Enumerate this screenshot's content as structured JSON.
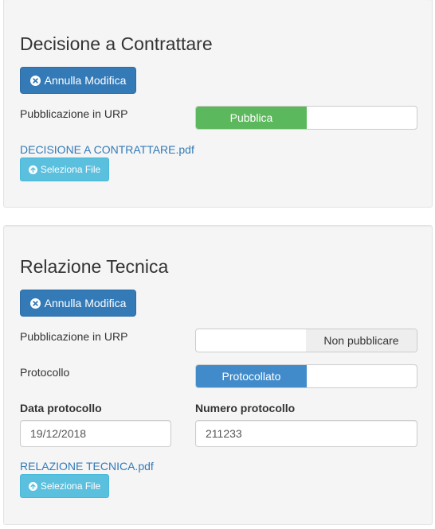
{
  "sections": [
    {
      "title": "Decisione a Contrattare",
      "cancel_button": "Annulla Modifica",
      "publication_label": "Pubblicazione in URP",
      "publication_toggle": {
        "on_label": "Pubblica",
        "off_label": "",
        "state": "on"
      },
      "file_link": "DECISIONE A CONTRATTARE.pdf",
      "select_file_button": "Seleziona File"
    },
    {
      "title": "Relazione Tecnica",
      "cancel_button": "Annulla Modifica",
      "publication_label": "Pubblicazione in URP",
      "publication_toggle": {
        "on_label": "",
        "off_label": "Non pubblicare",
        "state": "off"
      },
      "protocol_label": "Protocollo",
      "protocol_toggle": {
        "on_label": "Protocollato",
        "off_label": "",
        "state": "on"
      },
      "date_label": "Data protocollo",
      "date_value": "19/12/2018",
      "number_label": "Numero protocollo",
      "number_value": "211233",
      "file_link": "RELAZIONE TECNICA.pdf",
      "select_file_button": "Seleziona File"
    }
  ],
  "icons": {
    "cancel": "times-circle-icon",
    "upload": "upload-circle-icon"
  },
  "colors": {
    "primary": "#337ab7",
    "info": "#5bc0de",
    "success": "#5cb85c",
    "toggle_blue": "#428bca",
    "panel_bg": "#f5f5f5"
  }
}
